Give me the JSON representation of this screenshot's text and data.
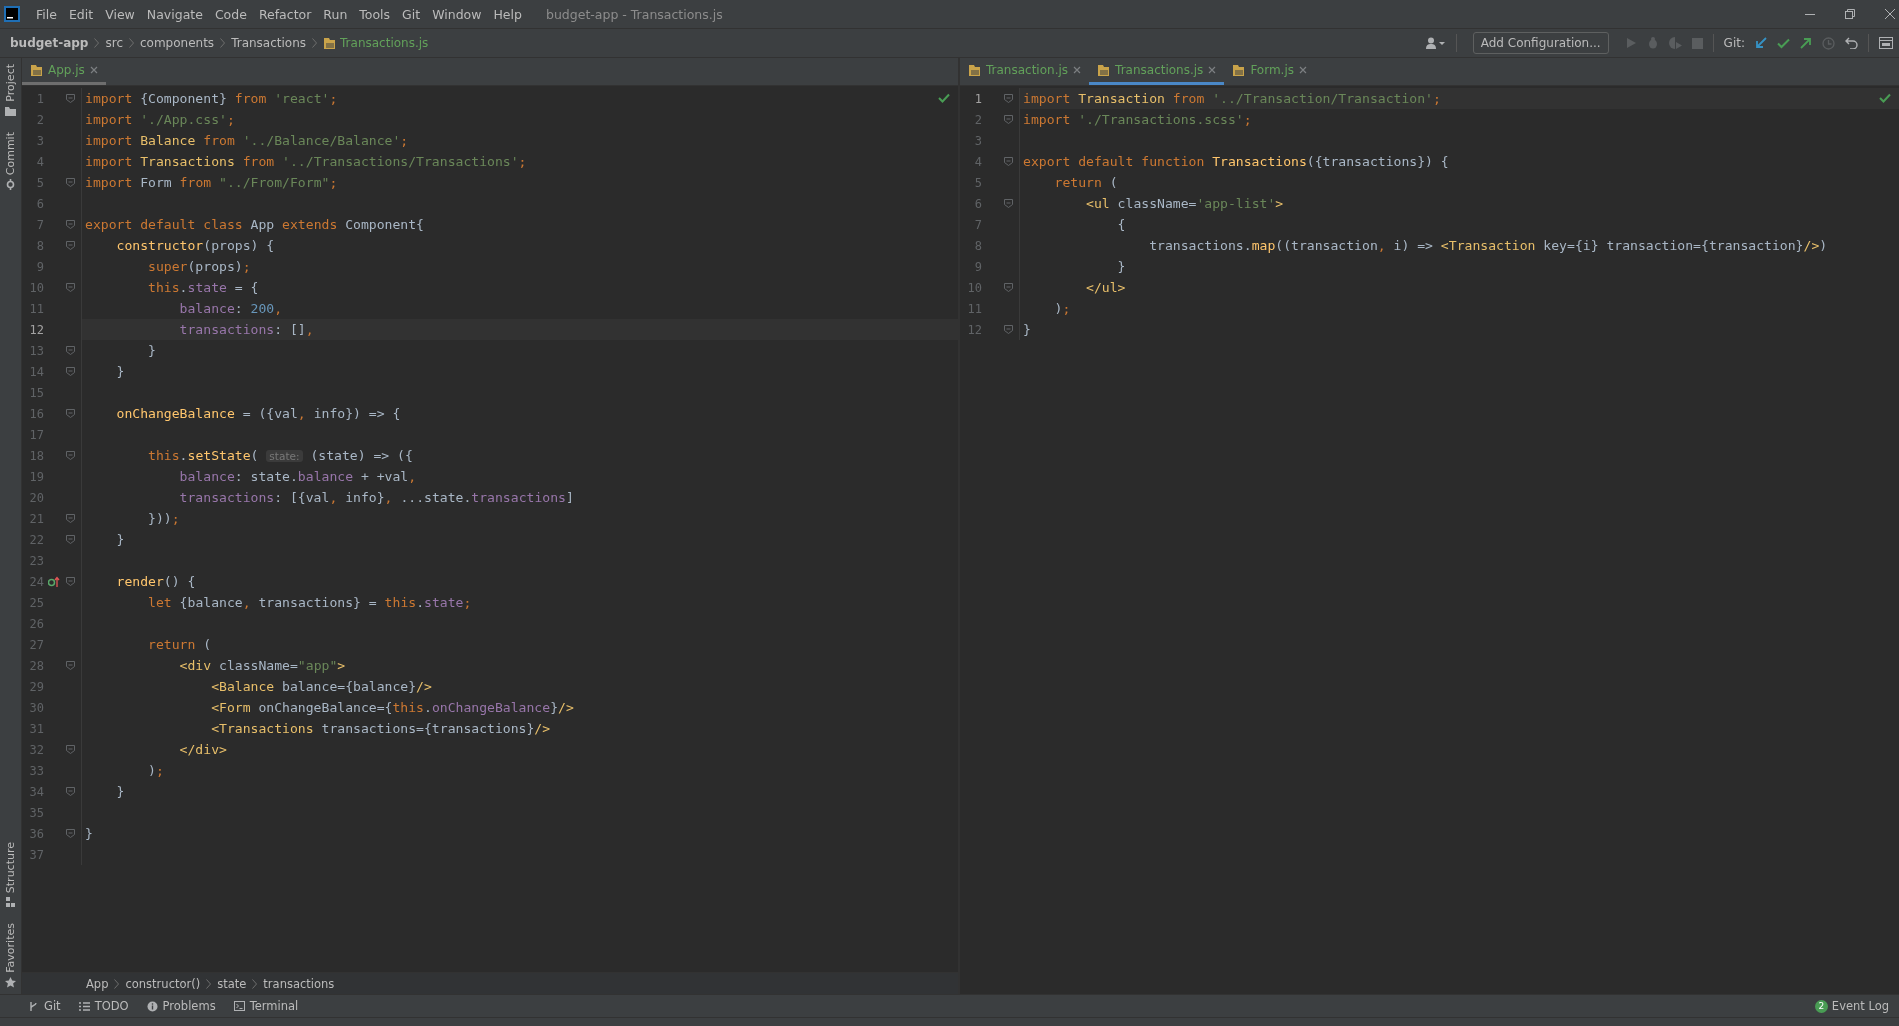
{
  "menu_bar": {
    "items": [
      "File",
      "Edit",
      "View",
      "Navigate",
      "Code",
      "Refactor",
      "Run",
      "Tools",
      "Git",
      "Window",
      "Help"
    ],
    "title": "budget-app - Transactions.js"
  },
  "nav_bar": {
    "breadcrumbs": [
      {
        "label": "budget-app",
        "kind": "project"
      },
      {
        "label": "src",
        "kind": "folder"
      },
      {
        "label": "components",
        "kind": "folder"
      },
      {
        "label": "Transactions",
        "kind": "folder"
      },
      {
        "label": "Transactions.js",
        "kind": "file"
      }
    ]
  },
  "toolbar": {
    "config_button": "Add Configuration...",
    "git_label": "Git:"
  },
  "side_tools": {
    "top": [
      {
        "label": "Project",
        "kind": "project"
      },
      {
        "label": "Commit",
        "kind": "commit"
      }
    ],
    "bottom": [
      {
        "label": "Structure",
        "kind": "structure"
      },
      {
        "label": "Favorites",
        "kind": "favorites"
      }
    ]
  },
  "editors": [
    {
      "focused": false,
      "tabs": [
        {
          "label": "App.js",
          "selected": true
        }
      ],
      "lines": [
        {
          "number": "1",
          "fold": true,
          "current": false,
          "tokens": [
            {
              "text": "import ",
              "kind": "kw"
            },
            {
              "text": "{Component} ",
              "kind": "plain"
            },
            {
              "text": "from ",
              "kind": "kw"
            },
            {
              "text": "'react'",
              "kind": "str"
            },
            {
              "text": ";",
              "kind": "kw"
            }
          ]
        },
        {
          "number": "2",
          "fold": false,
          "current": false,
          "tokens": [
            {
              "text": "import ",
              "kind": "kw"
            },
            {
              "text": "'./App.css'",
              "kind": "str"
            },
            {
              "text": ";",
              "kind": "kw"
            }
          ]
        },
        {
          "number": "3",
          "fold": false,
          "current": false,
          "tokens": [
            {
              "text": "import ",
              "kind": "kw"
            },
            {
              "text": "Balance ",
              "kind": "cls"
            },
            {
              "text": "from ",
              "kind": "kw"
            },
            {
              "text": "'../Balance/Balance'",
              "kind": "str"
            },
            {
              "text": ";",
              "kind": "kw"
            }
          ]
        },
        {
          "number": "4",
          "fold": false,
          "current": false,
          "tokens": [
            {
              "text": "import ",
              "kind": "kw"
            },
            {
              "text": "Transactions ",
              "kind": "cls"
            },
            {
              "text": "from ",
              "kind": "kw"
            },
            {
              "text": "'../Transactions/Transactions'",
              "kind": "str"
            },
            {
              "text": ";",
              "kind": "kw"
            }
          ]
        },
        {
          "number": "5",
          "fold": true,
          "current": false,
          "tokens": [
            {
              "text": "import ",
              "kind": "kw"
            },
            {
              "text": "Form ",
              "kind": "plain"
            },
            {
              "text": "from ",
              "kind": "kw"
            },
            {
              "text": "\"../From/Form\"",
              "kind": "str"
            },
            {
              "text": ";",
              "kind": "kw"
            }
          ]
        },
        {
          "number": "6",
          "fold": false,
          "current": false
        },
        {
          "number": "7",
          "fold": true,
          "current": false,
          "tokens": [
            {
              "text": "export default class ",
              "kind": "kw"
            },
            {
              "text": "App ",
              "kind": "plain"
            },
            {
              "text": "extends ",
              "kind": "kw"
            },
            {
              "text": "Component{",
              "kind": "plain"
            }
          ]
        },
        {
          "number": "8",
          "fold": true,
          "current": false,
          "tokens": [
            {
              "text": "    constructor",
              "kind": "fn"
            },
            {
              "text": "(props) {",
              "kind": "plain"
            }
          ]
        },
        {
          "number": "9",
          "fold": false,
          "current": false,
          "tokens": [
            {
              "text": "        super",
              "kind": "kw"
            },
            {
              "text": "(props)",
              "kind": "plain"
            },
            {
              "text": ";",
              "kind": "kw"
            }
          ]
        },
        {
          "number": "10",
          "fold": true,
          "current": false,
          "tokens": [
            {
              "text": "        this",
              "kind": "kw"
            },
            {
              "text": ".",
              "kind": "plain"
            },
            {
              "text": "state",
              "kind": "prop"
            },
            {
              "text": " = {",
              "kind": "plain"
            }
          ]
        },
        {
          "number": "11",
          "fold": false,
          "current": false,
          "tokens": [
            {
              "text": "            balance",
              "kind": "prop"
            },
            {
              "text": ": ",
              "kind": "plain"
            },
            {
              "text": "200",
              "kind": "num"
            },
            {
              "text": ",",
              "kind": "kw"
            }
          ]
        },
        {
          "number": "12",
          "fold": false,
          "current": true,
          "tokens": [
            {
              "text": "            transactions",
              "kind": "prop"
            },
            {
              "text": ": []",
              "kind": "plain"
            },
            {
              "text": ",",
              "kind": "kw"
            }
          ]
        },
        {
          "number": "13",
          "fold": true,
          "current": false,
          "tokens": [
            {
              "text": "        }",
              "kind": "plain"
            }
          ]
        },
        {
          "number": "14",
          "fold": true,
          "current": false,
          "tokens": [
            {
              "text": "    }",
              "kind": "plain"
            }
          ]
        },
        {
          "number": "15",
          "fold": false,
          "current": false
        },
        {
          "number": "16",
          "fold": true,
          "current": false,
          "tokens": [
            {
              "text": "    onChangeBalance",
              "kind": "fn"
            },
            {
              "text": " = ({val",
              "kind": "plain"
            },
            {
              "text": ", ",
              "kind": "kw"
            },
            {
              "text": "info}) => {",
              "kind": "plain"
            }
          ]
        },
        {
          "number": "17",
          "fold": false,
          "current": false
        },
        {
          "number": "18",
          "fold": true,
          "current": false,
          "tokens": [
            {
              "text": "        this",
              "kind": "kw"
            },
            {
              "text": ".",
              "kind": "plain"
            },
            {
              "text": "setState",
              "kind": "fn"
            },
            {
              "text": "( ",
              "kind": "plain"
            },
            {
              "text": "state:",
              "kind": "hint"
            },
            {
              "text": " (state) => ({",
              "kind": "plain"
            }
          ]
        },
        {
          "number": "19",
          "fold": false,
          "current": false,
          "tokens": [
            {
              "text": "            balance",
              "kind": "prop"
            },
            {
              "text": ": state.",
              "kind": "plain"
            },
            {
              "text": "balance",
              "kind": "prop"
            },
            {
              "text": " + +val",
              "kind": "plain"
            },
            {
              "text": ",",
              "kind": "kw"
            }
          ]
        },
        {
          "number": "20",
          "fold": false,
          "current": false,
          "tokens": [
            {
              "text": "            transactions",
              "kind": "prop"
            },
            {
              "text": ": [{val",
              "kind": "plain"
            },
            {
              "text": ", ",
              "kind": "kw"
            },
            {
              "text": "info}",
              "kind": "plain"
            },
            {
              "text": ", ",
              "kind": "kw"
            },
            {
              "text": "...state.",
              "kind": "plain"
            },
            {
              "text": "transactions",
              "kind": "prop"
            },
            {
              "text": "]",
              "kind": "plain"
            }
          ]
        },
        {
          "number": "21",
          "fold": true,
          "current": false,
          "tokens": [
            {
              "text": "        }))",
              "kind": "plain"
            },
            {
              "text": ";",
              "kind": "kw"
            }
          ]
        },
        {
          "number": "22",
          "fold": true,
          "current": false,
          "tokens": [
            {
              "text": "    }",
              "kind": "plain"
            }
          ]
        },
        {
          "number": "23",
          "fold": false,
          "current": false
        },
        {
          "number": "24",
          "fold": true,
          "current": false,
          "kind": "override",
          "tokens": [
            {
              "text": "    render",
              "kind": "fn"
            },
            {
              "text": "() {",
              "kind": "plain"
            }
          ]
        },
        {
          "number": "25",
          "fold": false,
          "current": false,
          "tokens": [
            {
              "text": "        let ",
              "kind": "kw"
            },
            {
              "text": "{balance",
              "kind": "plain"
            },
            {
              "text": ", ",
              "kind": "kw"
            },
            {
              "text": "transactions} = ",
              "kind": "plain"
            },
            {
              "text": "this",
              "kind": "kw"
            },
            {
              "text": ".",
              "kind": "plain"
            },
            {
              "text": "state",
              "kind": "prop"
            },
            {
              "text": ";",
              "kind": "kw"
            }
          ]
        },
        {
          "number": "26",
          "fold": false,
          "current": false
        },
        {
          "number": "27",
          "fold": false,
          "current": false,
          "tokens": [
            {
              "text": "        return ",
              "kind": "kw"
            },
            {
              "text": "(",
              "kind": "plain"
            }
          ]
        },
        {
          "number": "28",
          "fold": true,
          "current": false,
          "tokens": [
            {
              "text": "            <div ",
              "kind": "tag"
            },
            {
              "text": "className=",
              "kind": "plain"
            },
            {
              "text": "\"app\"",
              "kind": "str"
            },
            {
              "text": ">",
              "kind": "tag"
            }
          ]
        },
        {
          "number": "29",
          "fold": false,
          "current": false,
          "tokens": [
            {
              "text": "                <Balance ",
              "kind": "tag"
            },
            {
              "text": "balance={balance}",
              "kind": "plain"
            },
            {
              "text": "/>",
              "kind": "tag"
            }
          ]
        },
        {
          "number": "30",
          "fold": false,
          "current": false,
          "tokens": [
            {
              "text": "                <Form ",
              "kind": "tag"
            },
            {
              "text": "onChangeBalance={",
              "kind": "plain"
            },
            {
              "text": "this",
              "kind": "kw"
            },
            {
              "text": ".",
              "kind": "plain"
            },
            {
              "text": "onChangeBalance",
              "kind": "prop"
            },
            {
              "text": "}",
              "kind": "plain"
            },
            {
              "text": "/>",
              "kind": "tag"
            }
          ]
        },
        {
          "number": "31",
          "fold": false,
          "current": false,
          "tokens": [
            {
              "text": "                <Transactions ",
              "kind": "tag"
            },
            {
              "text": "transactions={transactions}",
              "kind": "plain"
            },
            {
              "text": "/>",
              "kind": "tag"
            }
          ]
        },
        {
          "number": "32",
          "fold": true,
          "current": false,
          "tokens": [
            {
              "text": "            </div>",
              "kind": "tag"
            }
          ]
        },
        {
          "number": "33",
          "fold": false,
          "current": false,
          "tokens": [
            {
              "text": "        )",
              "kind": "plain"
            },
            {
              "text": ";",
              "kind": "kw"
            }
          ]
        },
        {
          "number": "34",
          "fold": true,
          "current": false,
          "tokens": [
            {
              "text": "    }",
              "kind": "plain"
            }
          ]
        },
        {
          "number": "35",
          "fold": false,
          "current": false
        },
        {
          "number": "36",
          "fold": true,
          "current": false,
          "tokens": [
            {
              "text": "}",
              "kind": "plain"
            }
          ]
        },
        {
          "number": "37",
          "fold": false,
          "current": false
        }
      ],
      "breadcrumbs": [
        "App",
        "constructor()",
        "state",
        "transactions"
      ]
    },
    {
      "focused": true,
      "tabs": [
        {
          "label": "Transaction.js",
          "selected": false
        },
        {
          "label": "Transactions.js",
          "selected": true
        },
        {
          "label": "Form.js",
          "selected": false
        }
      ],
      "lines": [
        {
          "number": "1",
          "fold": true,
          "current": true,
          "tokens": [
            {
              "text": "import ",
              "kind": "kw"
            },
            {
              "text": "Transaction ",
              "kind": "cls"
            },
            {
              "text": "from ",
              "kind": "kw"
            },
            {
              "text": "'../Transaction/Transaction'",
              "kind": "str"
            },
            {
              "text": ";",
              "kind": "kw"
            }
          ]
        },
        {
          "number": "2",
          "fold": true,
          "current": false,
          "tokens": [
            {
              "text": "import ",
              "kind": "kw"
            },
            {
              "text": "'./Transactions.scss'",
              "kind": "str"
            },
            {
              "text": ";",
              "kind": "kw"
            }
          ]
        },
        {
          "number": "3",
          "fold": false,
          "current": false
        },
        {
          "number": "4",
          "fold": true,
          "current": false,
          "tokens": [
            {
              "text": "export default function ",
              "kind": "kw"
            },
            {
              "text": "Transactions",
              "kind": "fn"
            },
            {
              "text": "({transactions}) {",
              "kind": "plain"
            }
          ]
        },
        {
          "number": "5",
          "fold": false,
          "current": false,
          "tokens": [
            {
              "text": "    return ",
              "kind": "kw"
            },
            {
              "text": "(",
              "kind": "plain"
            }
          ]
        },
        {
          "number": "6",
          "fold": true,
          "current": false,
          "tokens": [
            {
              "text": "        <ul ",
              "kind": "tag"
            },
            {
              "text": "className=",
              "kind": "plain"
            },
            {
              "text": "'app-list'",
              "kind": "str"
            },
            {
              "text": ">",
              "kind": "tag"
            }
          ]
        },
        {
          "number": "7",
          "fold": false,
          "current": false,
          "tokens": [
            {
              "text": "            {",
              "kind": "plain"
            }
          ]
        },
        {
          "number": "8",
          "fold": false,
          "current": false,
          "tokens": [
            {
              "text": "                transactions.",
              "kind": "plain"
            },
            {
              "text": "map",
              "kind": "fn"
            },
            {
              "text": "((transaction",
              "kind": "plain"
            },
            {
              "text": ", ",
              "kind": "kw"
            },
            {
              "text": "i) => ",
              "kind": "plain"
            },
            {
              "text": "<Transaction ",
              "kind": "tag"
            },
            {
              "text": "key={i} transaction={transaction}",
              "kind": "plain"
            },
            {
              "text": "/>",
              "kind": "tag"
            },
            {
              "text": ")",
              "kind": "plain"
            }
          ]
        },
        {
          "number": "9",
          "fold": false,
          "current": false,
          "tokens": [
            {
              "text": "            }",
              "kind": "plain"
            }
          ]
        },
        {
          "number": "10",
          "fold": true,
          "current": false,
          "tokens": [
            {
              "text": "        </ul>",
              "kind": "tag"
            }
          ]
        },
        {
          "number": "11",
          "fold": false,
          "current": false,
          "tokens": [
            {
              "text": "    )",
              "kind": "plain"
            },
            {
              "text": ";",
              "kind": "kw"
            }
          ]
        },
        {
          "number": "12",
          "fold": true,
          "current": false,
          "tokens": [
            {
              "text": "}",
              "kind": "plain"
            }
          ]
        }
      ]
    }
  ],
  "tool_bar": {
    "items": [
      {
        "label": "Git",
        "kind": "git"
      },
      {
        "label": "TODO",
        "kind": "todo"
      },
      {
        "label": "Problems",
        "kind": "problems"
      },
      {
        "label": "Terminal",
        "kind": "terminal"
      }
    ],
    "event_log": {
      "label": "Event Log",
      "count": "2"
    }
  }
}
